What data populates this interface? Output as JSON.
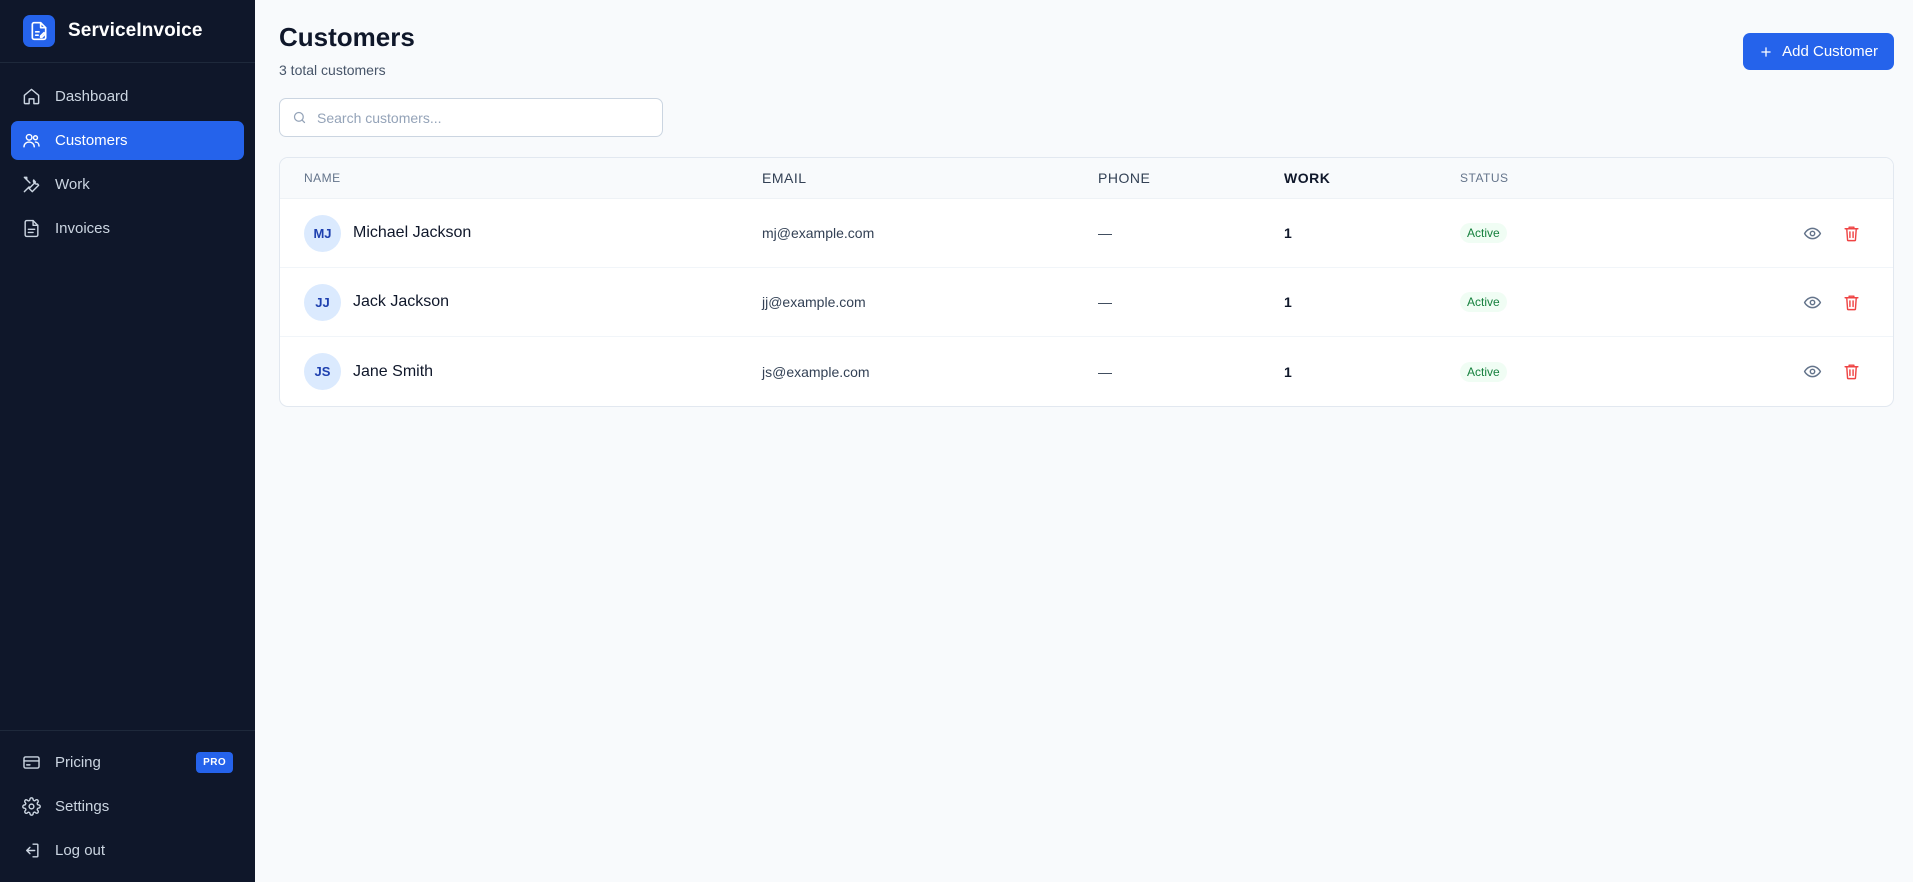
{
  "app": {
    "name": "ServiceInvoice"
  },
  "sidebar": {
    "items": [
      {
        "label": "Dashboard",
        "icon": "home-icon"
      },
      {
        "label": "Customers",
        "icon": "users-icon"
      },
      {
        "label": "Work",
        "icon": "tools-icon"
      },
      {
        "label": "Invoices",
        "icon": "document-icon"
      }
    ],
    "bottom": [
      {
        "label": "Pricing",
        "icon": "credit-card-icon",
        "badge": "PRO"
      },
      {
        "label": "Settings",
        "icon": "gear-icon"
      },
      {
        "label": "Log out",
        "icon": "logout-icon"
      }
    ]
  },
  "header": {
    "title": "Customers",
    "subtitle": "3 total customers",
    "add_label": "Add Customer"
  },
  "search": {
    "placeholder": "Search customers..."
  },
  "table": {
    "columns": [
      "NAME",
      "EMAIL",
      "PHONE",
      "WORK",
      "STATUS"
    ],
    "rows": [
      {
        "initials": "MJ",
        "name": "Michael Jackson",
        "email": "mj@example.com",
        "phone": "—",
        "work": "1",
        "status": "Active"
      },
      {
        "initials": "JJ",
        "name": "Jack Jackson",
        "email": "jj@example.com",
        "phone": "—",
        "work": "1",
        "status": "Active"
      },
      {
        "initials": "JS",
        "name": "Jane Smith",
        "email": "js@example.com",
        "phone": "—",
        "work": "1",
        "status": "Active"
      }
    ]
  },
  "colors": {
    "accent": "#2563eb",
    "sidebar": "#0f172a",
    "active_green": "#15803d",
    "danger": "#ef4444"
  }
}
